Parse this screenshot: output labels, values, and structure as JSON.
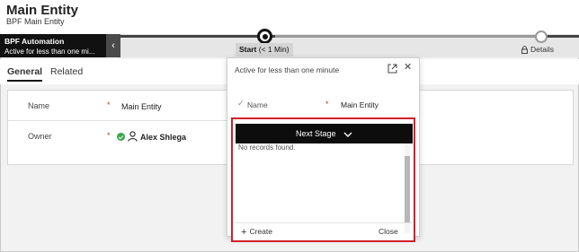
{
  "header": {
    "title": "Main Entity",
    "subtitle": "BPF Main Entity"
  },
  "bpf": {
    "flyout_title": "BPF Automation",
    "flyout_status": "Active for less than one mi...",
    "collapse_icon": "chevron-left-icon",
    "stages": [
      {
        "label": "Start",
        "duration": "(< 1 Min)",
        "state": "active"
      },
      {
        "label": "Details",
        "state": "locked",
        "icon": "lock-icon"
      }
    ]
  },
  "tabs": [
    {
      "label": "General",
      "selected": true
    },
    {
      "label": "Related",
      "selected": false
    }
  ],
  "form": {
    "fields": [
      {
        "label": "Name",
        "required_marker": "*",
        "value": "Main Entity"
      },
      {
        "label": "Owner",
        "required_marker": "*",
        "value": "Alex Shlega",
        "status_icon": "presence-available-icon",
        "type_icon": "person-icon"
      }
    ]
  },
  "stage_flyout": {
    "header": "Active for less than one minute",
    "expand_icon": "expand-icon",
    "close_icon": "close-icon",
    "field": {
      "label": "Name",
      "required_marker": "*",
      "value": "Main Entity",
      "icon": "checkmark-icon"
    },
    "next_stage_label": "Next Stage",
    "next_stage_icon": "chevron-down-icon",
    "empty_message": "No records found.",
    "create_label": "Create",
    "close_label": "Close",
    "highlight_color": "#d0202a"
  },
  "colors": {
    "flyout_background": "#111111",
    "presence_green": "#3aa74a",
    "required_red": "#c0392b"
  }
}
